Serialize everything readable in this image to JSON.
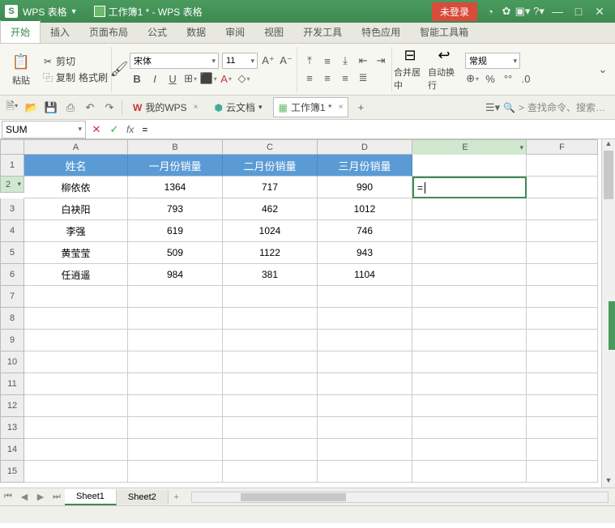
{
  "titlebar": {
    "app_abbrev": "S",
    "app_name": "WPS 表格",
    "doc_title": "工作簿1 * - WPS 表格",
    "login_label": "未登录"
  },
  "tabs": {
    "items": [
      "开始",
      "插入",
      "页面布局",
      "公式",
      "数据",
      "审阅",
      "视图",
      "开发工具",
      "特色应用",
      "智能工具箱"
    ],
    "active": 0
  },
  "ribbon": {
    "paste": "粘贴",
    "cut": "剪切",
    "copy": "复制",
    "format_painter": "格式刷",
    "font_name": "宋体",
    "font_size": "11",
    "merge_center": "合并居中",
    "wrap_text": "自动换行",
    "number_format": "常规"
  },
  "quickbar": {
    "mywps": "我的WPS",
    "cloud_doc": "云文档",
    "workbook_tab": "工作簿1 *",
    "search_placeholder": "查找命令、搜索…"
  },
  "formula_bar": {
    "name_box": "SUM",
    "formula": "="
  },
  "grid": {
    "col_letters": [
      "A",
      "B",
      "C",
      "D",
      "E",
      "F"
    ],
    "header_row": [
      "姓名",
      "一月份销量",
      "二月份销量",
      "三月份销量"
    ],
    "rows": [
      {
        "n": "1"
      },
      {
        "n": "2",
        "cells": [
          "柳依依",
          "1364",
          "717",
          "990"
        ],
        "e": "= "
      },
      {
        "n": "3",
        "cells": [
          "白袂阳",
          "793",
          "462",
          "1012"
        ]
      },
      {
        "n": "4",
        "cells": [
          "李强",
          "619",
          "1024",
          "746"
        ]
      },
      {
        "n": "5",
        "cells": [
          "黄莹莹",
          "509",
          "1122",
          "943"
        ]
      },
      {
        "n": "6",
        "cells": [
          "任逍遥",
          "984",
          "381",
          "1104"
        ]
      },
      {
        "n": "7"
      },
      {
        "n": "8"
      },
      {
        "n": "9"
      },
      {
        "n": "10"
      },
      {
        "n": "11"
      },
      {
        "n": "12"
      },
      {
        "n": "13"
      },
      {
        "n": "14"
      },
      {
        "n": "15"
      }
    ]
  },
  "sheets": {
    "items": [
      "Sheet1",
      "Sheet2"
    ],
    "active": 0,
    "add": "+"
  }
}
